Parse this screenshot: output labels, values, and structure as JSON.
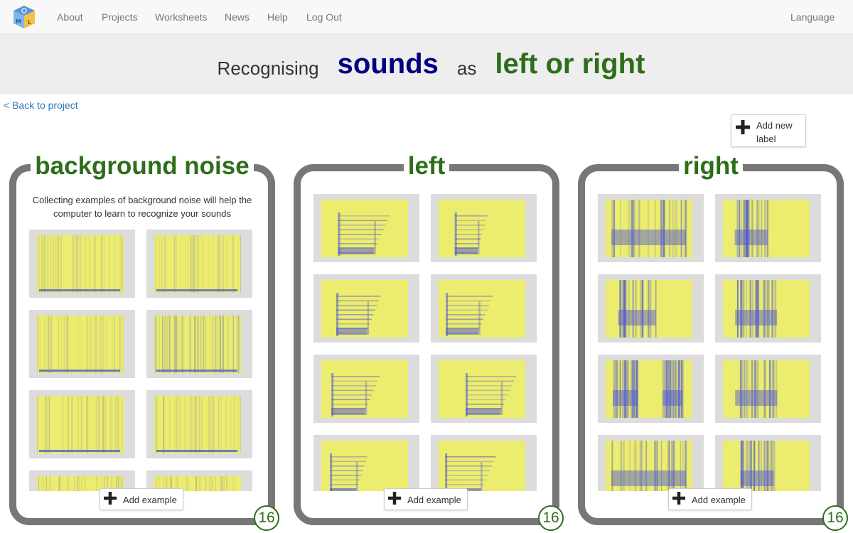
{
  "nav": {
    "items": [
      "About",
      "Projects",
      "Worksheets",
      "News",
      "Help",
      "Log Out"
    ],
    "language": "Language"
  },
  "title": {
    "prefix": "Recognising",
    "type": "sounds",
    "middle": "as",
    "project": "left or right"
  },
  "back_link": "< Back to project",
  "add_label_button": "Add new label",
  "labels": [
    {
      "name": "background noise",
      "description": "Collecting examples of background noise will help the computer to learn to recognize your sounds",
      "add_example": "Add example",
      "count": "16"
    },
    {
      "name": "left",
      "description": "",
      "add_example": "Add example",
      "count": "16"
    },
    {
      "name": "right",
      "description": "",
      "add_example": "Add example",
      "count": "16"
    }
  ],
  "colors": {
    "title_green": "#2e6e1b",
    "sounds_navy": "#000080",
    "panel_border": "#777777",
    "spectrogram_yellow": "#ecec6e",
    "spectrogram_blue": "#4b55d2"
  }
}
